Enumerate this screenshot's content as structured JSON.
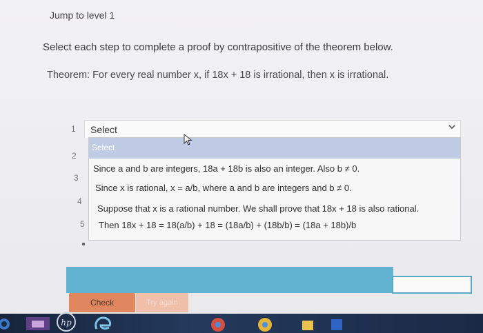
{
  "header": {
    "jump_label": "Jump to level 1"
  },
  "instructions": "Select each step to complete a proof by contrapositive of the theorem below.",
  "theorem": "Theorem: For every real number x, if 18x + 18 is irrational, then x is irrational.",
  "step_numbers": [
    "1",
    "2",
    "3",
    "4",
    "5"
  ],
  "select": {
    "current_value": "Select",
    "options": [
      "Select",
      "Since a and b are integers, 18a + 18b is also an integer. Also b ≠ 0.",
      "Since x is rational, x = a/b, where a and b are integers and b ≠ 0.",
      "Suppose that x is a rational number. We shall prove that 18x + 18 is also rational.",
      "Then 18x + 18 = 18(a/b) + 18 = (18a/b) + (18b/b) = (18a + 18b)/b"
    ]
  },
  "buttons": {
    "check": "Check",
    "try_again": "Try again"
  },
  "colors": {
    "accent_blue": "#62b2d1",
    "check_orange": "#e1875f",
    "selected_option": "#bfcbe4"
  },
  "taskbar": {
    "brand": "hp"
  }
}
